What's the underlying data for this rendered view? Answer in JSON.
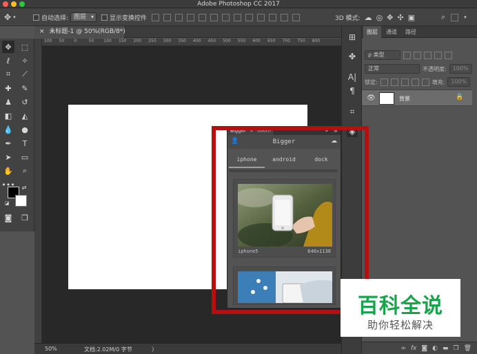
{
  "window": {
    "title": "Adobe Photoshop CC 2017"
  },
  "options_bar": {
    "auto_select_label": "自动选择:",
    "auto_select_value": "图层",
    "show_transform_label": "显示变换控件",
    "mode_3d_label": "3D 模式:"
  },
  "document": {
    "tab_label": "未标题-1 @ 50%(RGB/8*)",
    "close_glyph": "×",
    "ruler_ticks": [
      "100",
      "50",
      "0",
      "50",
      "100",
      "150",
      "200",
      "250",
      "300",
      "350",
      "400",
      "450",
      "500",
      "550",
      "600",
      "650",
      "700",
      "750",
      "800"
    ],
    "zoom": "50%",
    "doc_size": "文档:2.02M/0 字节",
    "status_arrow": "〉"
  },
  "layers_panel": {
    "tabs": [
      "图层",
      "通道",
      "路径"
    ],
    "filter_label": "ρ 类型",
    "blend_mode": "正常",
    "opacity_label": "不透明度:",
    "opacity_value": "100%",
    "lock_label": "锁定:",
    "fill_label": "填充:",
    "fill_value": "100%",
    "layer_name": "背景",
    "footer_icons": [
      "link-icon",
      "fx-icon",
      "mask-icon",
      "adjustment-icon",
      "folder-icon",
      "new-layer-icon",
      "trash-icon"
    ],
    "footer_fx": "fx"
  },
  "bigger_panel": {
    "tab_label": "Bigger",
    "tab_extra": "ooom",
    "title": "Bigger",
    "device_tabs": [
      "iphone",
      "android",
      "dock"
    ],
    "cards": [
      {
        "name": "iphone5",
        "size": "640x1136"
      }
    ]
  },
  "watermark": {
    "title": "百科全说",
    "subtitle": "助你轻松解决"
  },
  "colors": {
    "highlight": "#b41010",
    "watermark_green": "#1aa44a"
  }
}
